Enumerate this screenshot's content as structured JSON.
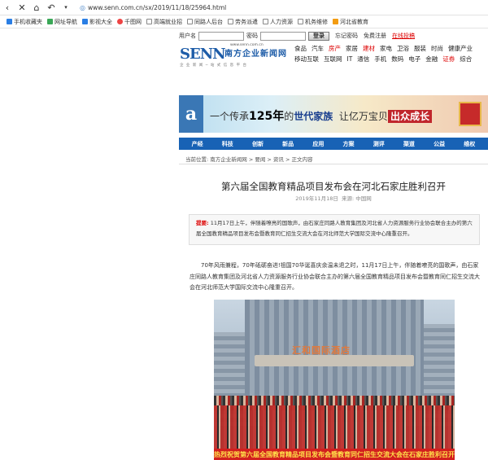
{
  "browser": {
    "url": "www.senn.com.cn/sx/2019/11/18/25964.html",
    "bookmarks": [
      "手机收藏夹",
      "网址导航",
      "影视大全",
      "千图网",
      "高端就业招",
      "同路人后台",
      "劳务派遣",
      "人力资源",
      "机务维修",
      "河北省教育"
    ]
  },
  "login": {
    "username_label": "用户名",
    "password_label": "密码",
    "login_button": "登录",
    "forgot": "忘记密码",
    "register": "免费注册",
    "online_submit": "在线投稿"
  },
  "logo": {
    "brand": "SENN",
    "cn_name": "南方企业新闻网",
    "url": "www.senn.com.cn",
    "slogan": "企 业 新 闻 ─ 站 式 信 息 平 台"
  },
  "topnav": {
    "items": [
      "食品",
      "汽车",
      "房产",
      "家居",
      "建材",
      "家电",
      "卫浴",
      "服装",
      "时尚",
      "健康产业",
      "移动互联",
      "互联网",
      "IT",
      "通信",
      "手机",
      "数码",
      "电子",
      "金融",
      "证券",
      "综合"
    ],
    "red": [
      2,
      4,
      18
    ]
  },
  "banner": {
    "part1": "一个传承",
    "num": "125年",
    "part2": "的",
    "part3": "世代家族",
    "part4": "让亿万宝贝",
    "part5": "出众成长"
  },
  "mainnav": [
    "产经",
    "科技",
    "创新",
    "新品",
    "应用",
    "方案",
    "测评",
    "渠道",
    "公益",
    "维权"
  ],
  "breadcrumb": "当前位置: 南方企业新闻网 > 要闻 > 资讯 > 正文内容",
  "article": {
    "title": "第六届全国教育精品项目发布会在河北石家庄胜利召开",
    "date": "2019年11月18日",
    "source": "来源: 中国网",
    "summary_lead": "提要:",
    "summary": "11月17日上午，伴随着嘹亮的国歌声，由石家庄同路人教育集团及河北省人力资源服务行业协会联合主办的第六届全国教育精品项目发布会暨教育同仁招生交流大会在河北师范大学国际交流中心隆重召开。",
    "paragraph": "70年风雨兼程，70年砥砺奋进!祖国70华诞喜庆余温未退之时，11月17日上午，伴随着嘹亮的国歌声，由石家庄同路人教育集团及河北省人力资源服务行业协会联合主办的第六届全国教育精品项目发布会暨教育同仁招生交流大会在河北师范大学国际交流中心隆重召开。",
    "photo_sign": "汇和国际酒店",
    "photo_banner": "热烈祝贺第六届全国教育精品项目发布会暨教育同仁招生交流大会在石家庄胜利召开"
  }
}
